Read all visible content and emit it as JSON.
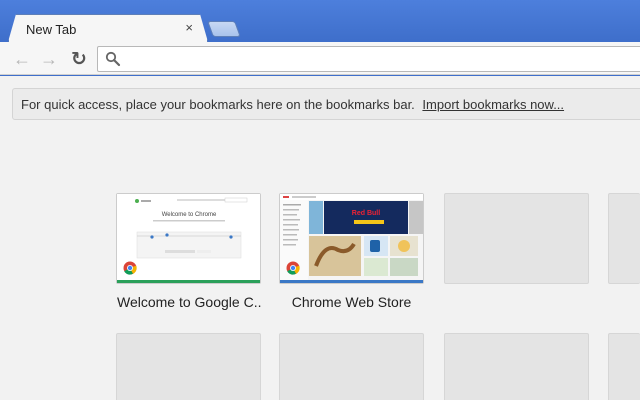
{
  "tab": {
    "title": "New Tab",
    "close_glyph": "×"
  },
  "toolbar": {
    "back_glyph": "←",
    "forward_glyph": "→",
    "reload_glyph": "↻",
    "omnibox_value": "",
    "omnibox_placeholder": ""
  },
  "bookmarks_bar": {
    "message": "For quick access, place your bookmarks here on the bookmarks bar.",
    "import_link": "Import bookmarks now..."
  },
  "most_visited": [
    {
      "label": "Welcome to Google C...",
      "preview": "welcome-page"
    },
    {
      "label": "Chrome Web Store",
      "preview": "web-store"
    }
  ],
  "preview_text": {
    "welcome_heading": "Welcome to Chrome",
    "store_badge": "Red Bull"
  },
  "colors": {
    "frame": "#4a78d3",
    "content_bg": "#f2f2f2",
    "green_accent": "#2aa05a",
    "blue_accent": "#3b78c6"
  }
}
